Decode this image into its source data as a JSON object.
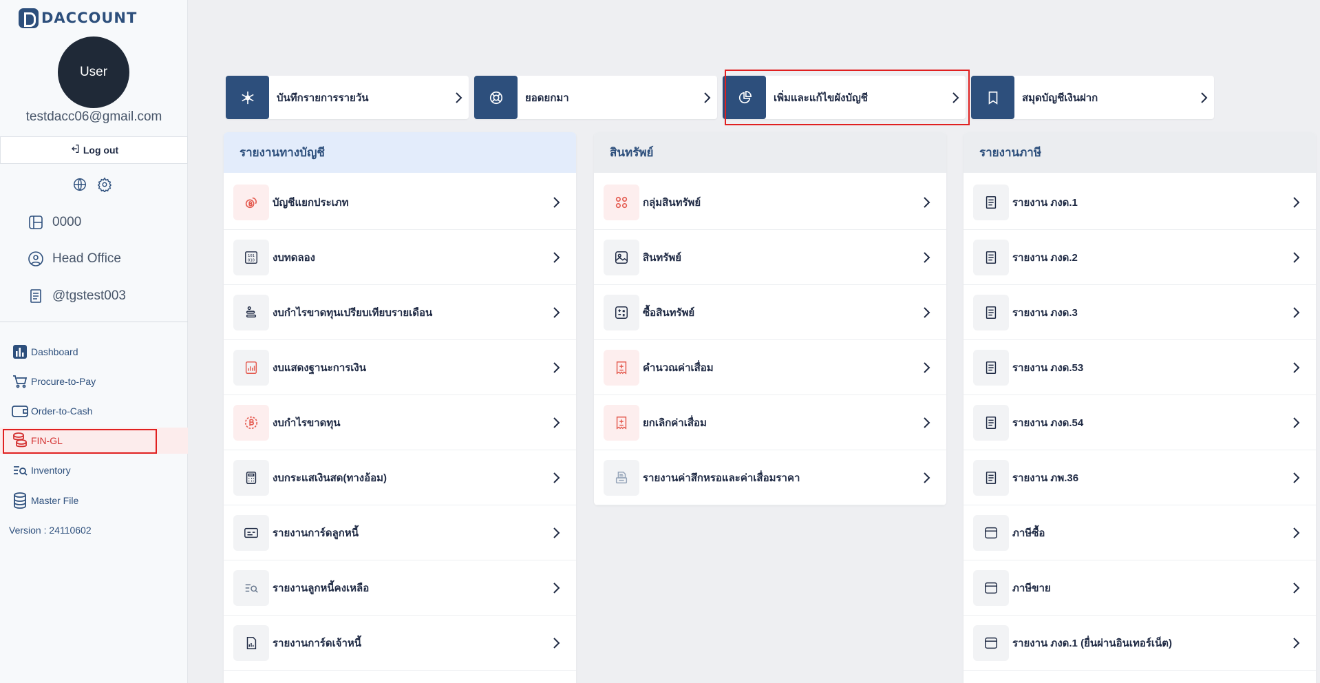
{
  "app": {
    "logo_text": "DACCOUNT"
  },
  "user": {
    "avatar_label": "User",
    "email": "testdacc06@gmail.com",
    "logout_label": "Log out"
  },
  "org": {
    "code": "0000",
    "branch": "Head Office",
    "account": "@tgstest003"
  },
  "nav": {
    "items": [
      {
        "label": "Dashboard",
        "icon": "bar-chart-icon"
      },
      {
        "label": "Procure-to-Pay",
        "icon": "cart-icon"
      },
      {
        "label": "Order-to-Cash",
        "icon": "wallet-icon"
      },
      {
        "label": "FIN-GL",
        "icon": "coins-icon",
        "active": true
      },
      {
        "label": "Inventory",
        "icon": "list-search-icon"
      },
      {
        "label": "Master File",
        "icon": "database-icon"
      }
    ],
    "version": "Version : 24110602"
  },
  "shortcuts": [
    {
      "label": "บันทึกรายการรายวัน",
      "icon": "snowflake-icon"
    },
    {
      "label": "ยอดยกมา",
      "icon": "compass-icon"
    },
    {
      "label": "เพิ่มและแก้ไขผังบัญชี",
      "icon": "pie-chart-icon",
      "highlighted": true
    },
    {
      "label": "สมุดบัญชีเงินฝาก",
      "icon": "bookmark-icon"
    }
  ],
  "columns": [
    {
      "title": "รายงานทางบัญชี",
      "rows": [
        {
          "label": "บัญชีแยกประเภท",
          "icon": "baht-coins-icon"
        },
        {
          "label": "งบทดลอง",
          "icon": "binary-icon"
        },
        {
          "label": "งบกำไรขาดทุนเปรียบเทียบรายเดือน",
          "icon": "stack-icon"
        },
        {
          "label": "งบแสดงฐานะการเงิน",
          "icon": "report-chart-icon"
        },
        {
          "label": "งบกำไรขาดทุน",
          "icon": "baht-circle-icon"
        },
        {
          "label": "งบกระแสเงินสด(ทางอ้อม)",
          "icon": "calculator-icon"
        },
        {
          "label": "รายงานการ์ดลูกหนี้",
          "icon": "card-icon"
        },
        {
          "label": "รายงานลูกหนี้คงเหลือ",
          "icon": "list-search-icon"
        },
        {
          "label": "รายงานการ์ดเจ้าหนี้",
          "icon": "file-chart-icon"
        }
      ]
    },
    {
      "title": "สินทรัพย์",
      "rows": [
        {
          "label": "กลุ่มสินทรัพย์",
          "icon": "grid-circles-icon"
        },
        {
          "label": "สินทรัพย์",
          "icon": "image-icon"
        },
        {
          "label": "ซื้อสินทรัพย์",
          "icon": "calculator-box-icon"
        },
        {
          "label": "คำนวณค่าเสื่อม",
          "icon": "receipt-plus-icon"
        },
        {
          "label": "ยกเลิกค่าเสื่อม",
          "icon": "receipt-plus-icon"
        },
        {
          "label": "รายงานค่าสึกหรอและค่าเสื่อมราคา",
          "icon": "printer-icon"
        }
      ]
    },
    {
      "title": "รายงานภาษี",
      "rows": [
        {
          "label": "รายงาน ภงด.1",
          "icon": "document-icon"
        },
        {
          "label": "รายงาน ภงด.2",
          "icon": "document-icon"
        },
        {
          "label": "รายงาน ภงด.3",
          "icon": "document-icon"
        },
        {
          "label": "รายงาน ภงด.53",
          "icon": "document-icon"
        },
        {
          "label": "รายงาน ภงด.54",
          "icon": "document-icon"
        },
        {
          "label": "รายงาน ภพ.36",
          "icon": "document-icon"
        },
        {
          "label": "ภาษีซื้อ",
          "icon": "window-icon"
        },
        {
          "label": "ภาษีขาย",
          "icon": "window-icon"
        },
        {
          "label": "รายงาน ภงด.1 (ยื่นผ่านอินเทอร์เน็ต)",
          "icon": "window-icon"
        }
      ]
    }
  ],
  "colors": {
    "primary": "#2d4f7c",
    "highlight": "#e02020",
    "active_bg": "#fcecec",
    "icon_red": "#e45a4f"
  }
}
